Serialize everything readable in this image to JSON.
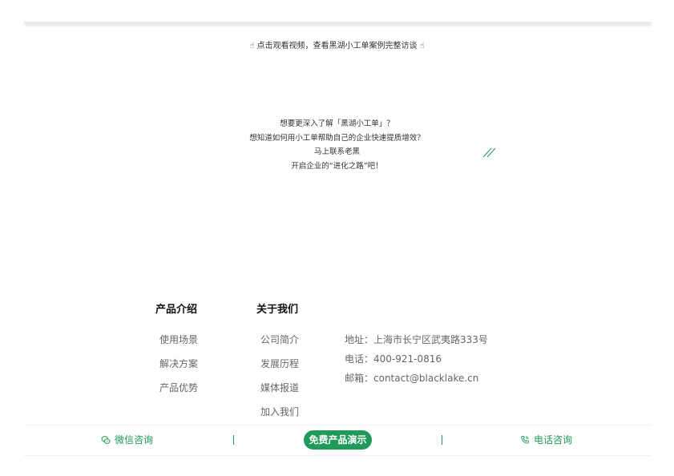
{
  "video": {
    "caption": "点击观看视频，查看黑湖小工单案例完整访谈",
    "hand_icon": "pointing-hand-icon"
  },
  "cta": {
    "line1": "想要更深入了解「黑湖小工单」？",
    "line2": "想知道如何用小工单帮助自己的企业快速提质增效？",
    "line3": "马上联系老黑",
    "line4": "开启企业的“进化之路”吧！"
  },
  "footer": {
    "product": {
      "title": "产品介绍",
      "items": [
        {
          "label": "使用场景"
        },
        {
          "label": "解决方案"
        },
        {
          "label": "产品优势"
        }
      ]
    },
    "about": {
      "title": "关于我们",
      "items": [
        {
          "label": "公司简介"
        },
        {
          "label": "发展历程"
        },
        {
          "label": "媒体报道"
        },
        {
          "label": "加入我们"
        }
      ]
    },
    "contact": {
      "address": "地址：上海市长宁区武夷路333号",
      "phone": "电话：400-921-0816",
      "email": "邮箱：contact@blacklake.cn"
    }
  },
  "bottom_bar": {
    "wechat_label": "微信咨询",
    "demo_label": "免费产品演示",
    "phone_label": "电话咨询"
  },
  "colors": {
    "brand_green": "#1f9a5a",
    "text": "#333333",
    "muted": "#666666"
  }
}
